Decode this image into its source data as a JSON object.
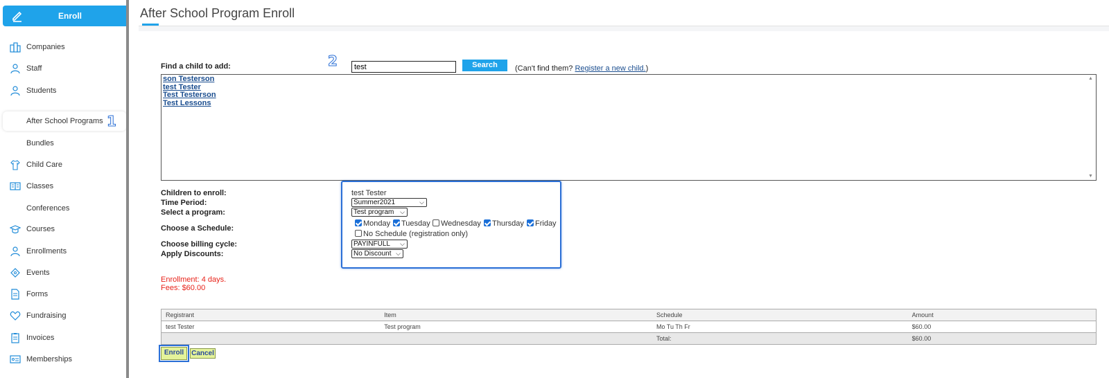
{
  "sidebar": {
    "enroll_label": "Enroll",
    "items": [
      {
        "label": "Companies",
        "icon": "companies-icon"
      },
      {
        "label": "Staff",
        "icon": "staff-icon"
      },
      {
        "label": "Students",
        "icon": "students-icon"
      },
      {
        "label": "After School Programs",
        "icon": ""
      },
      {
        "label": "Bundles",
        "icon": ""
      },
      {
        "label": "Child Care",
        "icon": "child-care-icon"
      },
      {
        "label": "Classes",
        "icon": "classes-icon"
      },
      {
        "label": "Conferences",
        "icon": ""
      },
      {
        "label": "Courses",
        "icon": "courses-icon"
      },
      {
        "label": "Enrollments",
        "icon": "enrollments-icon"
      },
      {
        "label": "Events",
        "icon": "events-icon"
      },
      {
        "label": "Forms",
        "icon": "forms-icon"
      },
      {
        "label": "Fundraising",
        "icon": "fundraising-icon"
      },
      {
        "label": "Invoices",
        "icon": "invoices-icon"
      },
      {
        "label": "Memberships",
        "icon": "memberships-icon"
      }
    ],
    "marker_1": "1"
  },
  "header": {
    "title": "After School Program Enroll"
  },
  "find_child": {
    "label": "Find a child to add:",
    "marker_2": "2",
    "search_value": "test",
    "search_button": "Search",
    "cant_find_prefix": "(Can't find them?",
    "register_link": "Register a new child.",
    "cant_find_suffix": ")",
    "results": [
      "son Testerson",
      "test Tester",
      "Test Testerson",
      "Test Lessons"
    ]
  },
  "form": {
    "children_label": "Children to enroll:",
    "children_value": "test Tester",
    "time_period_label": "Time Period:",
    "time_period_value": "Summer2021",
    "program_label": "Select a program:",
    "program_value": "Test program",
    "schedule_label": "Choose a Schedule:",
    "days": [
      {
        "label": "Monday",
        "checked": true
      },
      {
        "label": "Tuesday",
        "checked": true
      },
      {
        "label": "Wednesday",
        "checked": false
      },
      {
        "label": "Thursday",
        "checked": true
      },
      {
        "label": "Friday",
        "checked": true
      }
    ],
    "no_schedule_label": "No Schedule (registration only)",
    "billing_label": "Choose billing cycle:",
    "billing_value": "PAYINFULL",
    "discount_label": "Apply Discounts:",
    "discount_value": "No Discount"
  },
  "summary": {
    "enrollment_text": "Enrollment: 4 days.",
    "fees_text": "Fees: $60.00"
  },
  "table": {
    "headers": [
      "Registrant",
      "Item",
      "Schedule",
      "Amount"
    ],
    "row": [
      "test Tester",
      "Test program",
      "Mo Tu Th Fr",
      "$60.00"
    ],
    "total_label": "Total:",
    "total_value": "$60.00"
  },
  "actions": {
    "enroll": "Enroll",
    "cancel": "Cancel"
  },
  "colors": {
    "accent": "#1fa3ea",
    "highlight": "#2a6fd6",
    "error": "#e8231a",
    "button_bg": "#e4f39a"
  }
}
